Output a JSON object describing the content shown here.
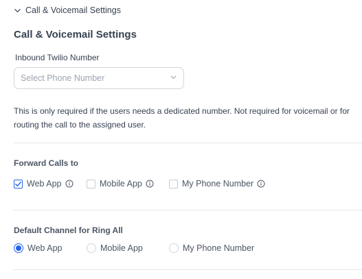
{
  "collapse_header": {
    "label": "Call & Voicemail Settings",
    "icon": "chevron-down-icon"
  },
  "section": {
    "title": "Call & Voicemail Settings"
  },
  "inbound_number": {
    "label": "Inbound Twilio Number",
    "placeholder": "Select Phone Number",
    "help_text": "This is only required if the users needs a dedicated number. Not required for voicemail or for routing the call to the assigned user."
  },
  "forward_calls": {
    "label": "Forward Calls to",
    "options": [
      {
        "label": "Web App",
        "checked": true,
        "info_icon": true
      },
      {
        "label": "Mobile App",
        "checked": false,
        "info_icon": true
      },
      {
        "label": "My Phone Number",
        "checked": false,
        "info_icon": true
      }
    ]
  },
  "default_channel": {
    "label": "Default Channel for Ring All",
    "options": [
      {
        "label": "Web App",
        "selected": true
      },
      {
        "label": "Mobile App",
        "selected": false
      },
      {
        "label": "My Phone Number",
        "selected": false
      }
    ]
  },
  "colors": {
    "accent": "#2563eb",
    "border": "#d1d5db",
    "text": "#374151",
    "placeholder": "#9ca3af",
    "divider": "#e5e7eb"
  }
}
